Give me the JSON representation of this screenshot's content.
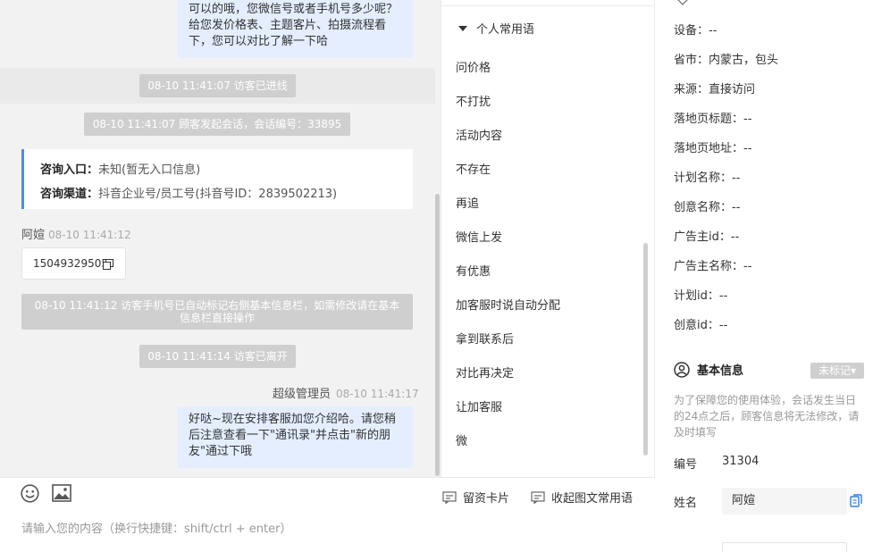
{
  "chat": {
    "top_message": "可以的哦，您微信号或者手机号多少呢？给您发价格表、主题客片、拍摄流程看下，您可以对比了解一下哈",
    "system_messages": {
      "entered": "08-10 11:41:07 访客已进线",
      "session": "08-10 11:41:07 顾客发起会话，会话编号：33895",
      "auto_mark": "08-10 11:41:12 访客手机号已自动标记右侧基本信息栏，如需修改请在基本信息栏直接操作",
      "left": "08-10 11:41:14 访客已离开"
    },
    "consult_card": {
      "entry_label": "咨询入口：",
      "entry_value": "未知(暂无入口信息)",
      "channel_label": "咨询渠道：",
      "channel_value": "抖音企业号/员工号(抖音号ID：2839502213)"
    },
    "visitor_message": {
      "sender": "阿媗",
      "time": "08-10 11:41:12",
      "text": "15049329505"
    },
    "agent_message": {
      "sender": "超级管理员",
      "time": "08-10 11:41:17",
      "text": "好哒~现在安排客服加您介绍哈。请您稍后注意查看一下\"通讯录\"并点击\"新的朋友\"通过下哦"
    }
  },
  "input": {
    "placeholder": "请输入您的内容（换行快捷键：shift/ctrl + enter）",
    "card_button": "留资卡片",
    "collapse_button": "收起图文常用语"
  },
  "phrases": {
    "header": "个人常用语",
    "items": [
      "问价格",
      "不打扰",
      "活动内容",
      "不存在",
      "再追",
      "微信上发",
      "有优惠",
      "加客服时说自动分配",
      "拿到联系后",
      "对比再决定",
      "让加客服",
      "微"
    ]
  },
  "visitor_info": {
    "rows": [
      {
        "label": "设备：",
        "value": "--"
      },
      {
        "label": "省市：",
        "value": "内蒙古，包头"
      },
      {
        "label": "来源：",
        "value": "直接访问"
      },
      {
        "label": "落地页标题：",
        "value": "--"
      },
      {
        "label": "落地页地址：",
        "value": "--"
      },
      {
        "label": "计划名称：",
        "value": "--"
      },
      {
        "label": "创意名称：",
        "value": "--"
      },
      {
        "label": "广告主id：",
        "value": "--"
      },
      {
        "label": "广告主名称：",
        "value": "--"
      },
      {
        "label": "计划id：",
        "value": "--"
      },
      {
        "label": "创意id：",
        "value": "--"
      }
    ],
    "basic_title": "基本信息",
    "unmarked_tag": "未标记▾",
    "notice": "为了保障您的使用体验，会话发生当日的24点之后，顾客信息将无法修改，请及时填写",
    "id_label": "编号",
    "id_value": "31304",
    "name_label": "姓名",
    "name_value": "阿媗"
  },
  "colors": {
    "accent": "#4a8af4",
    "bubble": "#e4eeff",
    "system_pill": "#cfcfcf"
  }
}
